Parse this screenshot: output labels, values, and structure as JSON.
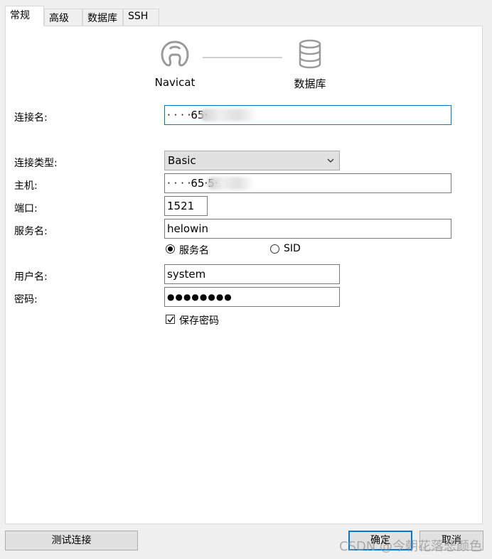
{
  "tabs": [
    "常规",
    "高级",
    "数据库",
    "SSH"
  ],
  "header": {
    "left_caption": "Navicat",
    "right_caption": "数据库",
    "left_icon": "navicat-logo-icon",
    "right_icon": "database-icon"
  },
  "form": {
    "connection_name_label": "连接名:",
    "connection_name_value": "· · · ·65·",
    "connection_type_label": "连接类型:",
    "connection_type_value": "Basic",
    "host_label": "主机:",
    "host_value": "· · · ·65·5·",
    "port_label": "端口:",
    "port_value": "1521",
    "service_label": "服务名:",
    "service_value": "helowin",
    "radio_service_label": "服务名",
    "radio_sid_label": "SID",
    "radio_selected": "服务名",
    "username_label": "用户名:",
    "username_value": "system",
    "password_label": "密码:",
    "password_value": "●●●●●●●●",
    "save_password_label": "保存密码",
    "save_password_checked": true
  },
  "buttons": {
    "test": "测试连接",
    "ok": "确定",
    "cancel": "取消"
  },
  "watermark": "CSDN @今朝花落悲颜色",
  "colors": {
    "accent": "#0078d7",
    "window_bg": "#f0f0f0",
    "panel_bg": "#ffffff"
  }
}
